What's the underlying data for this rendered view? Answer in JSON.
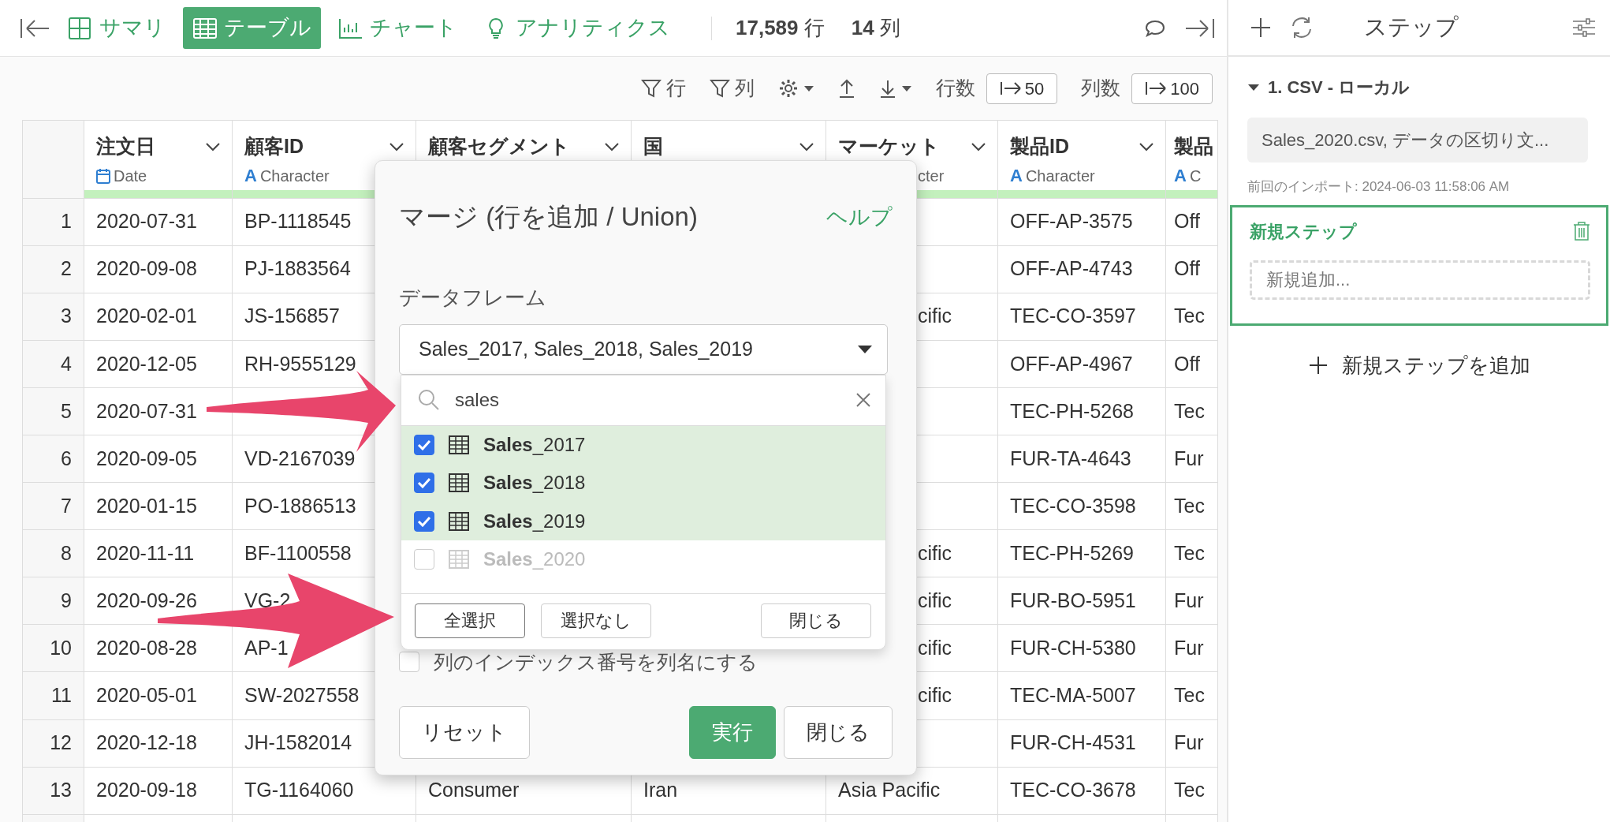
{
  "topbar": {
    "nav": [
      {
        "label": "サマリ",
        "kind": "summary",
        "selected": false
      },
      {
        "label": "テーブル",
        "kind": "table",
        "selected": true
      },
      {
        "label": "チャート",
        "kind": "chart",
        "selected": false
      },
      {
        "label": "アナリティクス",
        "kind": "analytics",
        "selected": false
      }
    ],
    "row_count": "17,589",
    "row_unit": "行",
    "col_count": "14",
    "col_unit": "列"
  },
  "tools": {
    "row_filter": "行",
    "col_filter": "列",
    "rows_label": "行数",
    "rows_value": "50",
    "cols_label": "列数",
    "cols_value": "100"
  },
  "table": {
    "columns": [
      {
        "name": "注文日",
        "type": "Date",
        "kind": "date"
      },
      {
        "name": "顧客ID",
        "type": "Character",
        "kind": "character",
        "glyph": "A"
      },
      {
        "name": "顧客セグメント"
      },
      {
        "name": "国"
      },
      {
        "name": "マーケット",
        "type": "cter",
        "clipped": true
      },
      {
        "name": "製品ID",
        "type": "Character",
        "kind": "character",
        "glyph": "A"
      },
      {
        "name": "製品",
        "type": "C",
        "kind": "character",
        "glyph": "A"
      }
    ],
    "rows": [
      {
        "index": "1",
        "cells": [
          "2020-07-31",
          "BP-1118545",
          null,
          null,
          null,
          "OFF-AP-3575",
          "Off"
        ]
      },
      {
        "index": "2",
        "cells": [
          "2020-09-08",
          "PJ-1883564",
          null,
          null,
          null,
          "OFF-AP-4743",
          "Off"
        ]
      },
      {
        "index": "3",
        "cells": [
          "2020-02-01",
          "JS-156857",
          null,
          null,
          {
            "text": "cific",
            "clipped": true
          },
          "TEC-CO-3597",
          "Tec"
        ]
      },
      {
        "index": "4",
        "cells": [
          "2020-12-05",
          "RH-9555129",
          null,
          null,
          null,
          "OFF-AP-4967",
          "Off"
        ]
      },
      {
        "index": "5",
        "cells": [
          "2020-07-31",
          null,
          null,
          null,
          null,
          "TEC-PH-5268",
          "Tec"
        ]
      },
      {
        "index": "6",
        "cells": [
          "2020-09-05",
          "VD-2167039",
          null,
          null,
          null,
          "FUR-TA-4643",
          "Fur"
        ]
      },
      {
        "index": "7",
        "cells": [
          "2020-01-15",
          "PO-1886513",
          null,
          null,
          null,
          "TEC-CO-3598",
          "Tec"
        ]
      },
      {
        "index": "8",
        "cells": [
          "2020-11-11",
          "BF-1100558",
          null,
          null,
          {
            "text": "cific",
            "clipped": true
          },
          "TEC-PH-5269",
          "Tec"
        ]
      },
      {
        "index": "9",
        "cells": [
          "2020-09-26",
          "VG-2",
          null,
          null,
          {
            "text": "cific",
            "clipped": true
          },
          "FUR-BO-5951",
          "Fur"
        ]
      },
      {
        "index": "10",
        "cells": [
          "2020-08-28",
          "AP-1",
          null,
          null,
          {
            "text": "cific",
            "clipped": true
          },
          "FUR-CH-5380",
          "Fur"
        ]
      },
      {
        "index": "11",
        "cells": [
          "2020-05-01",
          "SW-2027558",
          null,
          null,
          {
            "text": "cific",
            "clipped": true
          },
          "TEC-MA-5007",
          "Tec"
        ]
      },
      {
        "index": "12",
        "cells": [
          "2020-12-18",
          "JH-1582014",
          null,
          null,
          null,
          "FUR-CH-4531",
          "Fur"
        ]
      },
      {
        "index": "13",
        "cells": [
          "2020-09-18",
          "TG-1164060",
          "Consumer",
          "Iran",
          {
            "text": "Asia Pacific",
            "clipped": false
          },
          "TEC-CO-3678",
          "Tec"
        ]
      }
    ]
  },
  "dialog": {
    "title": "マージ (行を追加 / Union)",
    "help": "ヘルプ",
    "field_label": "データフレーム",
    "select_value": "Sales_2017, Sales_2018, Sales_2019",
    "menu": {
      "search": "sales",
      "options": [
        {
          "label": "**Sales**_2017",
          "checked": true,
          "selected": true,
          "disabled": false
        },
        {
          "label": "**Sales**_2018",
          "checked": true,
          "selected": true,
          "disabled": false
        },
        {
          "label": "**Sales**_2019",
          "checked": true,
          "selected": true,
          "disabled": false
        },
        {
          "label": "**Sales**_2020",
          "checked": false,
          "selected": false,
          "disabled": true
        }
      ],
      "buttons": [
        "全選択",
        "選択なし",
        "閉じる"
      ]
    },
    "index_option": {
      "label": "列のインデックス番号を列名にする",
      "checked": false
    },
    "reset": "リセット",
    "run": "実行",
    "close": "閉じる"
  },
  "steps": {
    "title": "ステップ",
    "group": {
      "title": "1. CSV - ローカル",
      "expanded": true,
      "summary": "Sales_2020.csv, データの区切り文...",
      "last_import": "前回のインポート: 2024-06-03 11:58:06 AM"
    },
    "new_step": {
      "title": "新規ステップ",
      "placeholder": "新規追加..."
    },
    "add": "新規ステップを追加"
  }
}
